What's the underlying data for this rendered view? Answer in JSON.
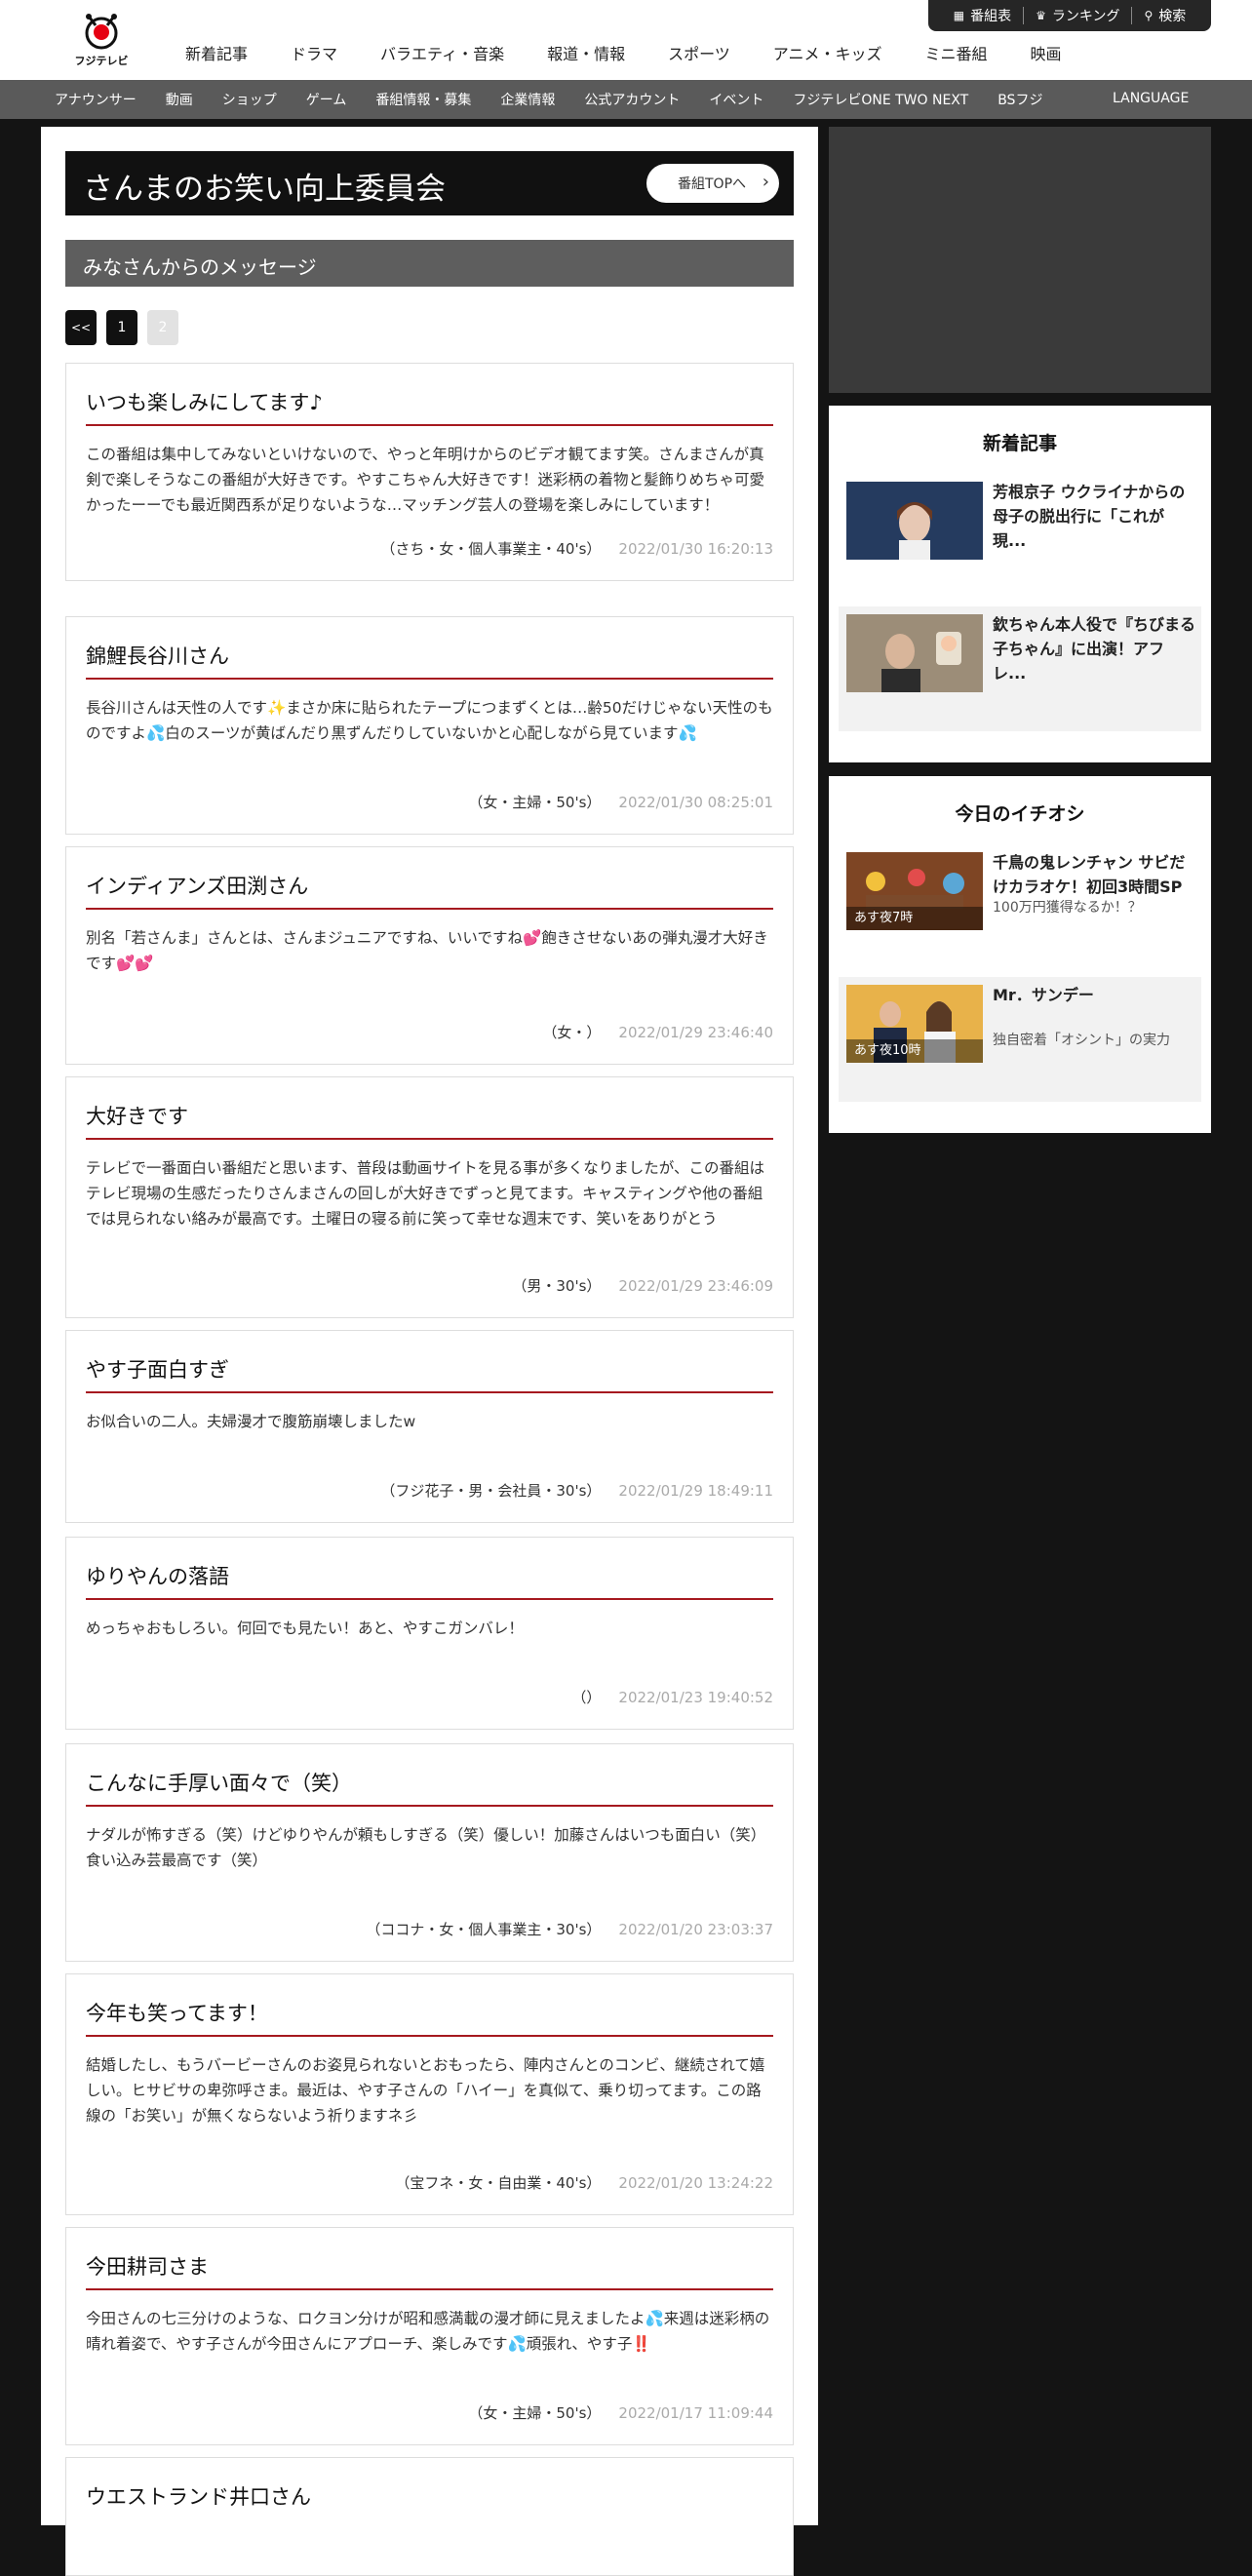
{
  "header": {
    "logo_text": "フジテレビ",
    "nav": [
      "新着記事",
      "ドラマ",
      "バラエティ・音楽",
      "報道・情報",
      "スポーツ",
      "アニメ・キッズ",
      "ミニ番組",
      "映画"
    ],
    "utility": [
      {
        "icon": "grid-icon",
        "label": "番組表"
      },
      {
        "icon": "crown-icon",
        "label": "ランキング"
      },
      {
        "icon": "search-icon",
        "label": "検索"
      }
    ]
  },
  "subnav": {
    "items": [
      "アナウンサー",
      "動画",
      "ショップ",
      "ゲーム",
      "番組情報・募集",
      "企業情報",
      "公式アカウント",
      "イベント",
      "フジテレビONE TWO NEXT",
      "BSフジ"
    ],
    "language": "LANGUAGE"
  },
  "program": {
    "title": "さんまのお笑い向上委員会",
    "top_button": "番組TOPへ"
  },
  "section_title": "みなさんからのメッセージ",
  "pagination": {
    "prev": "<<",
    "pages": [
      "1",
      "2"
    ],
    "current": "2"
  },
  "messages": [
    {
      "title": "いつも楽しみにしてます♪",
      "body": "この番組は集中してみないといけないので、やっと年明けからのビデオ観てます笑。さんまさんが真剣で楽しそうなこの番組が大好きです。やすこちゃん大好きです！迷彩柄の着物と髪飾りめちゃ可愛かったーーでも最近関西系が足りないような…マッチング芸人の登場を楽しみにしています！",
      "author": "（さち・女・個人事業主・40's）",
      "date": "2022/01/30 16:20:13"
    },
    {
      "title": "錦鯉長谷川さん",
      "body": "長谷川さんは天性の人です✨まさか床に貼られたテープにつまずくとは…齢50だけじゃない天性のものですよ💦白のスーツが黄ばんだり黒ずんだりしていないかと心配しながら見ています💦",
      "author": "（女・主婦・50's）",
      "date": "2022/01/30 08:25:01"
    },
    {
      "title": "インディアンズ田渕さん",
      "body": "別名「若さんま」さんとは、さんまジュニアですね、いいですね💕飽きさせないあの弾丸漫才大好きです💕💕",
      "author": "（女・）",
      "date": "2022/01/29 23:46:40"
    },
    {
      "title": "大好きです",
      "body": "テレビで一番面白い番組だと思います、普段は動画サイトを見る事が多くなりましたが、この番組はテレビ現場の生感だったりさんまさんの回しが大好きでずっと見てます。キャスティングや他の番組では見られない絡みが最高です。土曜日の寝る前に笑って幸せな週末です、笑いをありがとう",
      "author": "（男・30's）",
      "date": "2022/01/29 23:46:09"
    },
    {
      "title": "やす子面白すぎ",
      "body": "お似合いの二人。夫婦漫才で腹筋崩壊しましたw",
      "author": "（フジ花子・男・会社員・30's）",
      "date": "2022/01/29 18:49:11"
    },
    {
      "title": "ゆりやんの落語",
      "body": "めっちゃおもしろい。何回でも見たい！あと、やすこガンバレ！",
      "author": "（）",
      "date": "2022/01/23 19:40:52"
    },
    {
      "title": "こんなに手厚い面々で（笑）",
      "body": "ナダルが怖すぎる（笑）けどゆりやんが頼もしすぎる（笑）優しい！加藤さんはいつも面白い（笑）食い込み芸最高です（笑）",
      "author": "（ココナ・女・個人事業主・30's）",
      "date": "2022/01/20 23:03:37"
    },
    {
      "title": "今年も笑ってます！",
      "body": "結婚したし、もうバービーさんのお姿見られないとおもったら、陣内さんとのコンビ、継続されて嬉しい。ヒサビサの卑弥呼さま。最近は、やす子さんの「ハイー」を真似て、乗り切ってます。この路線の「お笑い」が無くならないよう祈りますネ彡",
      "author": "（宝フネ・女・自由業・40's）",
      "date": "2022/01/20 13:24:22"
    },
    {
      "title": "今田耕司さま",
      "body": "今田さんの七三分けのような、ロクヨン分けが昭和感満載の漫才師に見えましたよ💦来週は迷彩柄の晴れ着姿で、やす子さんが今田さんにアプローチ、楽しみです💦頑張れ、やす子‼️",
      "author": "（女・主婦・50's）",
      "date": "2022/01/17 11:09:44"
    },
    {
      "title": "ウエストランド井口さん",
      "body": "",
      "author": "",
      "date": ""
    }
  ],
  "sidebar": {
    "new_title": "新着記事",
    "new_items": [
      {
        "title": "芳根京子 ウクライナからの母子の脱出行に「これが現..."
      },
      {
        "title": "欽ちゃん本人役で『ちびまる子ちゃん』に出演！アフレ..."
      }
    ],
    "pick_title": "今日のイチオシ",
    "pick_items": [
      {
        "title": "千鳥の鬼レンチャン サビだけカラオケ！初回3時間SP",
        "sub": "100万円獲得なるか！？",
        "caption": "あす夜7時"
      },
      {
        "title": "Mr．サンデー",
        "sub": "独自密着「オシント」の実力",
        "caption": "あす夜10時"
      }
    ]
  },
  "colors": {
    "accent_red": "#a6191f",
    "dark": "#111111",
    "bg": "#141414"
  }
}
